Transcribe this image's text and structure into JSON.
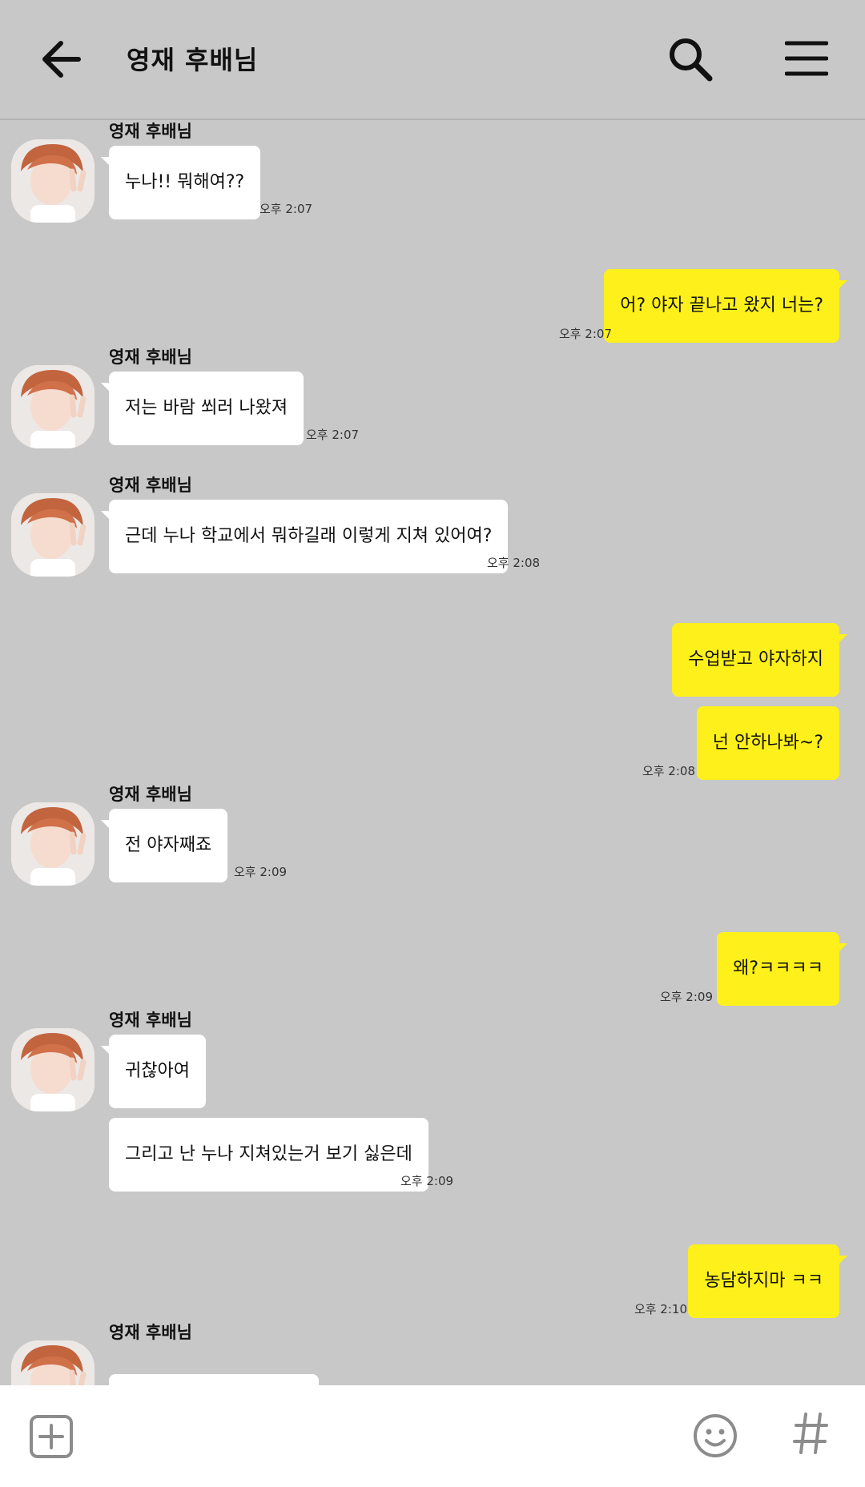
{
  "header": {
    "title": "영재 후배님"
  },
  "colors": {
    "background": "#c8c8c8",
    "my_bubble": "#fef01b",
    "their_bubble": "#ffffff"
  },
  "icons": {
    "back": "arrow-left-icon",
    "search": "search-icon",
    "menu": "hamburger-menu-icon",
    "add": "plus-square-icon",
    "emoji": "smiley-icon",
    "hashtag": "hashtag-icon"
  },
  "messages": [
    {
      "from": "them",
      "sender": "영재 후배님",
      "text": "누나!! 뭐해여??",
      "time": "오후 2:07"
    },
    {
      "from": "me",
      "text": "어? 야자 끝나고 왔지 너는?",
      "time": "오후 2:07"
    },
    {
      "from": "them",
      "sender": "영재 후배님",
      "text": "저는 바람 쐬러 나왔져",
      "time": "오후 2:07"
    },
    {
      "from": "them",
      "sender": "영재 후배님",
      "text": "근데 누나 학교에서 뭐하길래 이렇게 지쳐 있어여?",
      "time": "오후 2:08"
    },
    {
      "from": "me",
      "text": "수업받고 야자하지"
    },
    {
      "from": "me",
      "text": "넌 안하나봐~?",
      "time": "오후 2:08"
    },
    {
      "from": "them",
      "sender": "영재 후배님",
      "text": "전 야자째죠",
      "time": "오후 2:09"
    },
    {
      "from": "me",
      "text": "왜?ㅋㅋㅋㅋ",
      "time": "오후 2:09"
    },
    {
      "from": "them",
      "sender": "영재 후배님",
      "text": "귀찮아여"
    },
    {
      "from": "them",
      "text": "그리고 난 누나 지쳐있는거 보기 싫은데",
      "time": "오후 2:09"
    },
    {
      "from": "me",
      "text": "농담하지마 ㅋㅋ",
      "time": "오후 2:10"
    },
    {
      "from": "them",
      "sender": "영재 후배님",
      "text": ""
    }
  ]
}
